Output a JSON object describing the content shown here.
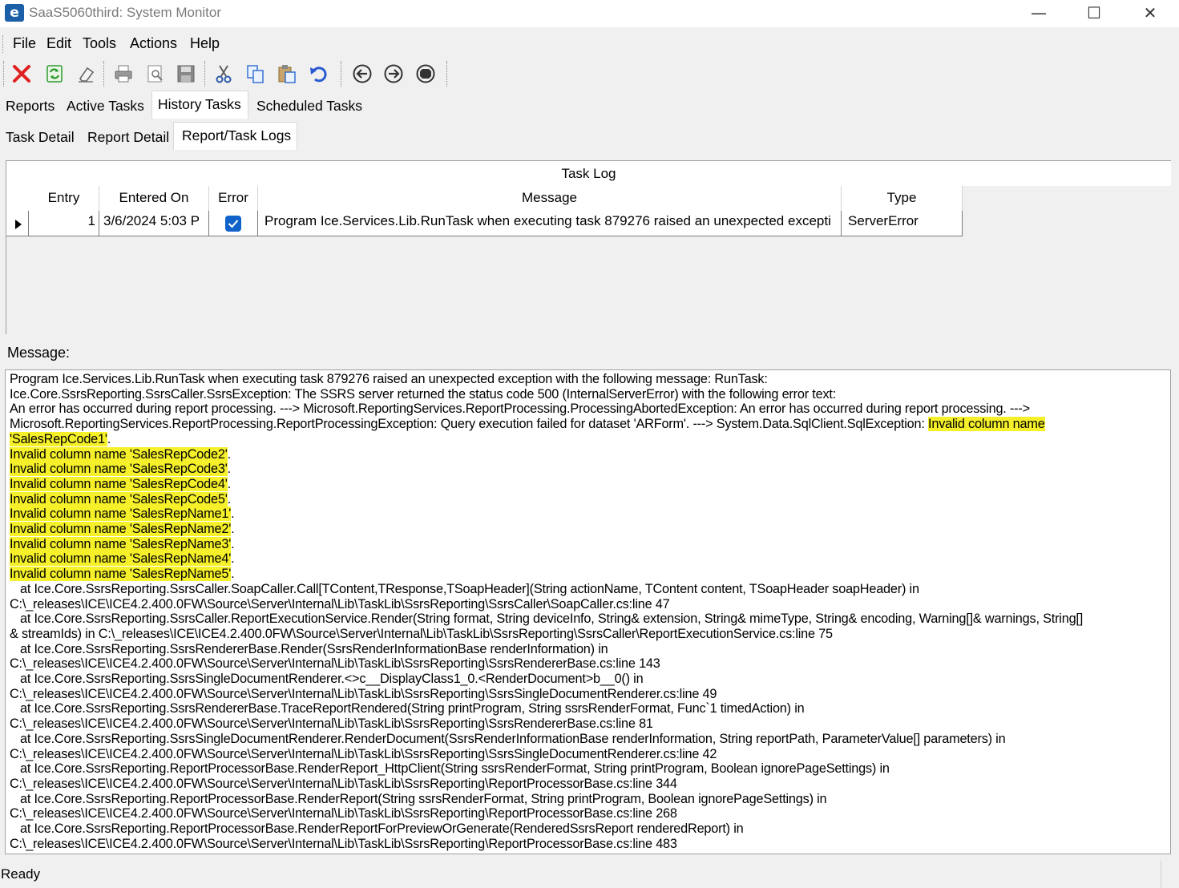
{
  "window": {
    "title": "SaaS5060third: System Monitor",
    "app_icon": "e",
    "controls": {
      "minimize": "—",
      "maximize": "☐",
      "close": "✕"
    }
  },
  "menu": [
    "File",
    "Edit",
    "Tools",
    "Actions",
    "Help"
  ],
  "toolbar": {
    "icons": [
      "delete-icon",
      "refresh-icon",
      "clear-icon",
      "print-icon",
      "print-preview-icon",
      "save-icon",
      "cut-icon",
      "copy-icon",
      "paste-icon",
      "undo-icon",
      "back-icon",
      "forward-icon",
      "stop-icon"
    ]
  },
  "main_tabs": [
    "Reports",
    "Active Tasks",
    "History Tasks",
    "Scheduled Tasks"
  ],
  "main_tabs_active": "History Tasks",
  "sub_tabs": [
    "Task Detail",
    "Report Detail",
    "Report/Task Logs"
  ],
  "sub_tabs_active": "Report/Task Logs",
  "task_log": {
    "caption": "Task Log",
    "columns": [
      "Entry",
      "Entered On",
      "Error",
      "Message",
      "Type"
    ],
    "rows": [
      {
        "entry": "1",
        "entered_on": "3/6/2024 5:03 P",
        "error": true,
        "message": "Program Ice.Services.Lib.RunTask when executing task 879276 raised an unexpected excepti",
        "type": "ServerError"
      }
    ]
  },
  "message_section": {
    "label": "Message:",
    "lines": [
      "Program Ice.Services.Lib.RunTask when executing task 879276 raised an unexpected exception with the following message: RunTask:",
      "Ice.Core.SsrsReporting.SsrsCaller.SsrsException: The SSRS server returned the status code 500 (InternalServerError) with the following error text:",
      "An error has occurred during report processing. ---> Microsoft.ReportingServices.ReportProcessing.ProcessingAbortedException: An error has occurred during report processing. --->",
      "Microsoft.ReportingServices.ReportProcessing.ReportProcessingException: Query execution failed for dataset 'ARForm'. ---> System.Data.SqlClient.SqlException: ",
      "Invalid column name",
      "'SalesRepCode1'",
      ".",
      "Invalid column name 'SalesRepCode2'",
      "Invalid column name 'SalesRepCode3'",
      "Invalid column name 'SalesRepCode4'",
      "Invalid column name 'SalesRepCode5'",
      "Invalid column name 'SalesRepName1'",
      "Invalid column name 'SalesRepName2'",
      "Invalid column name 'SalesRepName3'",
      "Invalid column name 'SalesRepName4'",
      "Invalid column name 'SalesRepName5'",
      "   at Ice.Core.SsrsReporting.SsrsCaller.SoapCaller.Call[TContent,TResponse,TSoapHeader](String actionName, TContent content, TSoapHeader soapHeader) in",
      "C:\\_releases\\ICE\\ICE4.2.400.0FW\\Source\\Server\\Internal\\Lib\\TaskLib\\SsrsReporting\\SsrsCaller\\SoapCaller.cs:line 47",
      "   at Ice.Core.SsrsReporting.SsrsCaller.ReportExecutionService.Render(String format, String deviceInfo, String& extension, String& mimeType, String& encoding, Warning[]& warnings, String[]",
      "& streamIds) in C:\\_releases\\ICE\\ICE4.2.400.0FW\\Source\\Server\\Internal\\Lib\\TaskLib\\SsrsReporting\\SsrsCaller\\ReportExecutionService.cs:line 75",
      "   at Ice.Core.SsrsReporting.SsrsRendererBase.Render(SsrsRenderInformationBase renderInformation) in",
      "C:\\_releases\\ICE\\ICE4.2.400.0FW\\Source\\Server\\Internal\\Lib\\TaskLib\\SsrsReporting\\SsrsRendererBase.cs:line 143",
      "   at Ice.Core.SsrsReporting.SsrsSingleDocumentRenderer.<>c__DisplayClass1_0.<RenderDocument>b__0() in",
      "C:\\_releases\\ICE\\ICE4.2.400.0FW\\Source\\Server\\Internal\\Lib\\TaskLib\\SsrsReporting\\SsrsSingleDocumentRenderer.cs:line 49",
      "   at Ice.Core.SsrsReporting.SsrsRendererBase.TraceReportRendered(String printProgram, String ssrsRenderFormat, Func`1 timedAction) in",
      "C:\\_releases\\ICE\\ICE4.2.400.0FW\\Source\\Server\\Internal\\Lib\\TaskLib\\SsrsReporting\\SsrsRendererBase.cs:line 81",
      "   at Ice.Core.SsrsReporting.SsrsSingleDocumentRenderer.RenderDocument(SsrsRenderInformationBase renderInformation, String reportPath, ParameterValue[] parameters) in",
      "C:\\_releases\\ICE\\ICE4.2.400.0FW\\Source\\Server\\Internal\\Lib\\TaskLib\\SsrsReporting\\SsrsSingleDocumentRenderer.cs:line 42",
      "   at Ice.Core.SsrsReporting.ReportProcessorBase.RenderReport_HttpClient(String ssrsRenderFormat, String printProgram, Boolean ignorePageSettings) in",
      "C:\\_releases\\ICE\\ICE4.2.400.0FW\\Source\\Server\\Internal\\Lib\\TaskLib\\SsrsReporting\\ReportProcessorBase.cs:line 344",
      "   at Ice.Core.SsrsReporting.ReportProcessorBase.RenderReport(String ssrsRenderFormat, String printProgram, Boolean ignorePageSettings) in",
      "C:\\_releases\\ICE\\ICE4.2.400.0FW\\Source\\Server\\Internal\\Lib\\TaskLib\\SsrsReporting\\ReportProcessorBase.cs:line 268",
      "   at Ice.Core.SsrsReporting.ReportProcessorBase.RenderReportForPreviewOrGenerate(RenderedSsrsReport renderedReport) in",
      "C:\\_releases\\ICE\\ICE4.2.400.0FW\\Source\\Server\\Internal\\Lib\\TaskLib\\SsrsReporting\\ReportProcessorBase.cs:line 483"
    ],
    "highlight_color": "#f5f02a"
  },
  "status": {
    "text": "Ready"
  },
  "colors": {
    "accent": "#0f62c9",
    "delete_red": "#e02020",
    "refresh_green": "#2d9a2d"
  }
}
